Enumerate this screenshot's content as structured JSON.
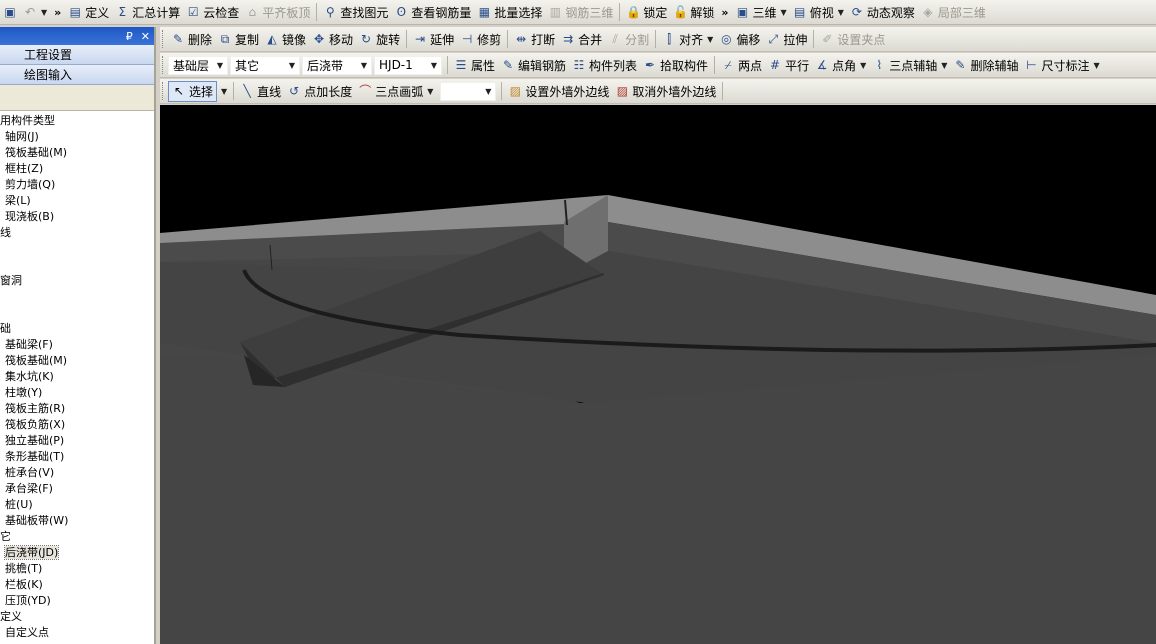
{
  "toolbar_main": {
    "more": "»",
    "items": [
      {
        "label": "定义",
        "icon": "define-icon",
        "glyph": "▤",
        "disabled": false
      },
      {
        "label": "汇总计算",
        "icon": "sigma-icon",
        "glyph": "Σ",
        "disabled": false
      },
      {
        "label": "云检查",
        "icon": "cloud-check-icon",
        "glyph": "☑",
        "disabled": false
      },
      {
        "label": "平齐板顶",
        "icon": "align-slab-top-icon",
        "glyph": "⌂",
        "disabled": true
      },
      {
        "label": "查找图元",
        "icon": "binoculars-icon",
        "glyph": "⚲",
        "disabled": false
      },
      {
        "label": "查看钢筋量",
        "icon": "rebar-icon",
        "glyph": "ʘ",
        "disabled": false
      },
      {
        "label": "批量选择",
        "icon": "batch-select-icon",
        "glyph": "▦",
        "disabled": false
      },
      {
        "label": "钢筋三维",
        "icon": "rebar-3d-icon",
        "glyph": "▥",
        "disabled": true
      },
      {
        "label": "锁定",
        "icon": "lock-icon",
        "glyph": "🔒",
        "disabled": false
      },
      {
        "label": "解锁",
        "icon": "unlock-icon",
        "glyph": "🔓",
        "disabled": false
      }
    ],
    "view": [
      {
        "label": "三维",
        "icon": "cube-icon",
        "dropdown": true,
        "disabled": false
      },
      {
        "label": "俯视",
        "icon": "top-view-icon",
        "dropdown": true,
        "disabled": false
      },
      {
        "label": "动态观察",
        "icon": "orbit-icon",
        "dropdown": false,
        "disabled": false
      },
      {
        "label": "局部三维",
        "icon": "local-3d-icon",
        "dropdown": false,
        "disabled": true
      }
    ]
  },
  "toolbar_edit": [
    {
      "label": "删除",
      "icon": "delete-icon",
      "glyph": "✎",
      "disabled": false
    },
    {
      "label": "复制",
      "icon": "copy-icon",
      "glyph": "⧉",
      "disabled": false
    },
    {
      "label": "镜像",
      "icon": "mirror-icon",
      "glyph": "◭",
      "disabled": false
    },
    {
      "label": "移动",
      "icon": "move-icon",
      "glyph": "✥",
      "disabled": false
    },
    {
      "label": "旋转",
      "icon": "rotate-icon",
      "glyph": "↻",
      "disabled": false
    },
    {
      "label": "延伸",
      "icon": "extend-icon",
      "glyph": "⇥",
      "disabled": false
    },
    {
      "label": "修剪",
      "icon": "trim-icon",
      "glyph": "⊣",
      "disabled": false
    },
    {
      "label": "打断",
      "icon": "break-icon",
      "glyph": "⇹",
      "disabled": false
    },
    {
      "label": "合并",
      "icon": "merge-icon",
      "glyph": "⇉",
      "disabled": false
    },
    {
      "label": "分割",
      "icon": "split-icon",
      "glyph": "⫽",
      "disabled": true
    },
    {
      "label": "对齐",
      "icon": "align-icon",
      "glyph": "⫿",
      "disabled": false,
      "dropdown": true
    },
    {
      "label": "偏移",
      "icon": "offset-icon",
      "glyph": "◎",
      "disabled": false
    },
    {
      "label": "拉伸",
      "icon": "stretch-icon",
      "glyph": "⤢",
      "disabled": false
    },
    {
      "label": "设置夹点",
      "icon": "grip-point-icon",
      "glyph": "✐",
      "disabled": true
    }
  ],
  "selectors": {
    "floor": "基础层",
    "category": "其它",
    "component_type": "后浇带",
    "component": "HJD-1"
  },
  "toolbar_props": [
    {
      "label": "属性",
      "icon": "properties-icon",
      "glyph": "☰",
      "disabled": false
    },
    {
      "label": "编辑钢筋",
      "icon": "edit-rebar-icon",
      "glyph": "✎",
      "disabled": false
    },
    {
      "label": "构件列表",
      "icon": "component-list-icon",
      "glyph": "☷",
      "disabled": false
    },
    {
      "label": "拾取构件",
      "icon": "pick-component-icon",
      "glyph": "✒",
      "disabled": false
    }
  ],
  "toolbar_axis": [
    {
      "label": "两点",
      "icon": "two-point-axis-icon",
      "glyph": "⌿",
      "disabled": false,
      "dropdown": false
    },
    {
      "label": "平行",
      "icon": "parallel-axis-icon",
      "glyph": "#",
      "disabled": false,
      "dropdown": false
    },
    {
      "label": "点角",
      "icon": "point-angle-icon",
      "glyph": "∡",
      "disabled": false,
      "dropdown": true
    },
    {
      "label": "三点辅轴",
      "icon": "three-point-axis-icon",
      "glyph": "⌇",
      "disabled": false,
      "dropdown": true
    },
    {
      "label": "删除辅轴",
      "icon": "delete-axis-icon",
      "glyph": "✎",
      "disabled": false,
      "dropdown": false
    },
    {
      "label": "尺寸标注",
      "icon": "dimension-icon",
      "glyph": "⊢",
      "disabled": false,
      "dropdown": true
    }
  ],
  "toolbar_draw": {
    "select": "选择",
    "line": "直线",
    "point_length": "点加长度",
    "arc": "三点画弧",
    "arc_combo_value": "",
    "set_outer": "设置外墙外边线",
    "cancel_outer": "取消外墙外边线"
  },
  "panel": {
    "title": "",
    "pin": "₽",
    "close": "✕",
    "tab_settings": "工程设置",
    "tab_draw": "绘图输入",
    "tree": [
      {
        "label": "用构件类型",
        "level": 0
      },
      {
        "label": "轴网(J)",
        "level": 1
      },
      {
        "label": "筏板基础(M)",
        "level": 1
      },
      {
        "label": "框柱(Z)",
        "level": 1
      },
      {
        "label": "剪力墙(Q)",
        "level": 1
      },
      {
        "label": "梁(L)",
        "level": 1
      },
      {
        "label": "现浇板(B)",
        "level": 1
      },
      {
        "label": "线",
        "level": 0
      },
      {
        "label": "",
        "level": 0
      },
      {
        "label": "",
        "level": 0
      },
      {
        "label": "窗洞",
        "level": 0
      },
      {
        "label": "",
        "level": 0
      },
      {
        "label": "",
        "level": 0
      },
      {
        "label": "础",
        "level": 0
      },
      {
        "label": "基础梁(F)",
        "level": 1
      },
      {
        "label": "筏板基础(M)",
        "level": 1
      },
      {
        "label": "集水坑(K)",
        "level": 1
      },
      {
        "label": "柱墩(Y)",
        "level": 1
      },
      {
        "label": "筏板主筋(R)",
        "level": 1
      },
      {
        "label": "筏板负筋(X)",
        "level": 1
      },
      {
        "label": "独立基础(P)",
        "level": 1
      },
      {
        "label": "条形基础(T)",
        "level": 1
      },
      {
        "label": "桩承台(V)",
        "level": 1
      },
      {
        "label": "承台梁(F)",
        "level": 1
      },
      {
        "label": "桩(U)",
        "level": 1
      },
      {
        "label": "基础板带(W)",
        "level": 1
      },
      {
        "label": "它",
        "level": 0
      },
      {
        "label": "后浇带(JD)",
        "level": 1,
        "selected": true
      },
      {
        "label": "挑檐(T)",
        "level": 1
      },
      {
        "label": "栏板(K)",
        "level": 1
      },
      {
        "label": "压顶(YD)",
        "level": 1
      },
      {
        "label": "定义",
        "level": 0
      },
      {
        "label": "自定义点",
        "level": 1
      }
    ]
  },
  "scene": {
    "background": "#000000",
    "slab_top_color": "#8a8a8a",
    "slab_side_color": "#4a4a4a",
    "slab_bottom_color": "#464646",
    "beam_color": "#3a3a3a"
  }
}
